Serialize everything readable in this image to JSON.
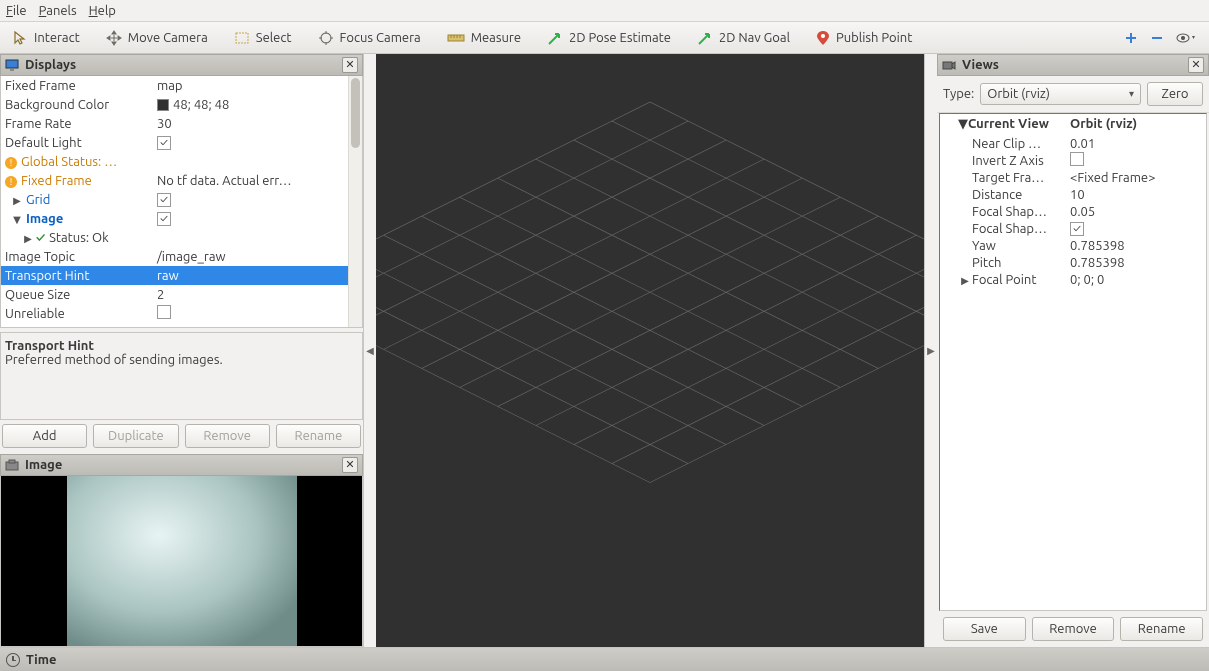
{
  "menu": {
    "file": "File",
    "panels": "Panels",
    "help": "Help"
  },
  "toolbar": {
    "interact": "Interact",
    "move": "Move Camera",
    "select": "Select",
    "focus": "Focus Camera",
    "measure": "Measure",
    "pose": "2D Pose Estimate",
    "nav": "2D Nav Goal",
    "publish": "Publish Point"
  },
  "displays": {
    "title": "Displays",
    "rows": {
      "fixed_frame_l": "Fixed Frame",
      "fixed_frame_v": "map",
      "bg_l": "Background Color",
      "bg_v": "48; 48; 48",
      "fr_l": "Frame Rate",
      "fr_v": "30",
      "dl_l": "Default Light",
      "gs_l": "Global Status: …",
      "ff_l": "Fixed Frame",
      "ff_v": "No tf data.  Actual err…",
      "grid_l": "Grid",
      "image_l": "Image",
      "status_l": "Status: Ok",
      "topic_l": "Image Topic",
      "topic_v": "/image_raw",
      "th_l": "Transport Hint",
      "th_v": "raw",
      "qs_l": "Queue Size",
      "qs_v": "2",
      "unrel_l": "Unreliable"
    },
    "desc_title": "Transport Hint",
    "desc_text": "Preferred method of sending images.",
    "btn_add": "Add",
    "btn_dup": "Duplicate",
    "btn_rem": "Remove",
    "btn_ren": "Rename"
  },
  "image_panel": {
    "title": "Image"
  },
  "views": {
    "title": "Views",
    "type_label": "Type:",
    "combo": "Orbit (rviz)",
    "zero": "Zero",
    "head_l": "Current View",
    "head_r": "Orbit (rviz)",
    "rows": {
      "near_l": "Near Clip …",
      "near_v": "0.01",
      "inv_l": "Invert Z Axis",
      "tgt_l": "Target Fra…",
      "tgt_v": "<Fixed Frame>",
      "dist_l": "Distance",
      "dist_v": "10",
      "fs1_l": "Focal Shap…",
      "fs1_v": "0.05",
      "fs2_l": "Focal Shap…",
      "yaw_l": "Yaw",
      "yaw_v": "0.785398",
      "pitch_l": "Pitch",
      "pitch_v": "0.785398",
      "fp_l": "Focal Point",
      "fp_v": "0; 0; 0"
    },
    "btn_save": "Save",
    "btn_remove": "Remove",
    "btn_rename": "Rename"
  },
  "time": {
    "title": "Time"
  }
}
